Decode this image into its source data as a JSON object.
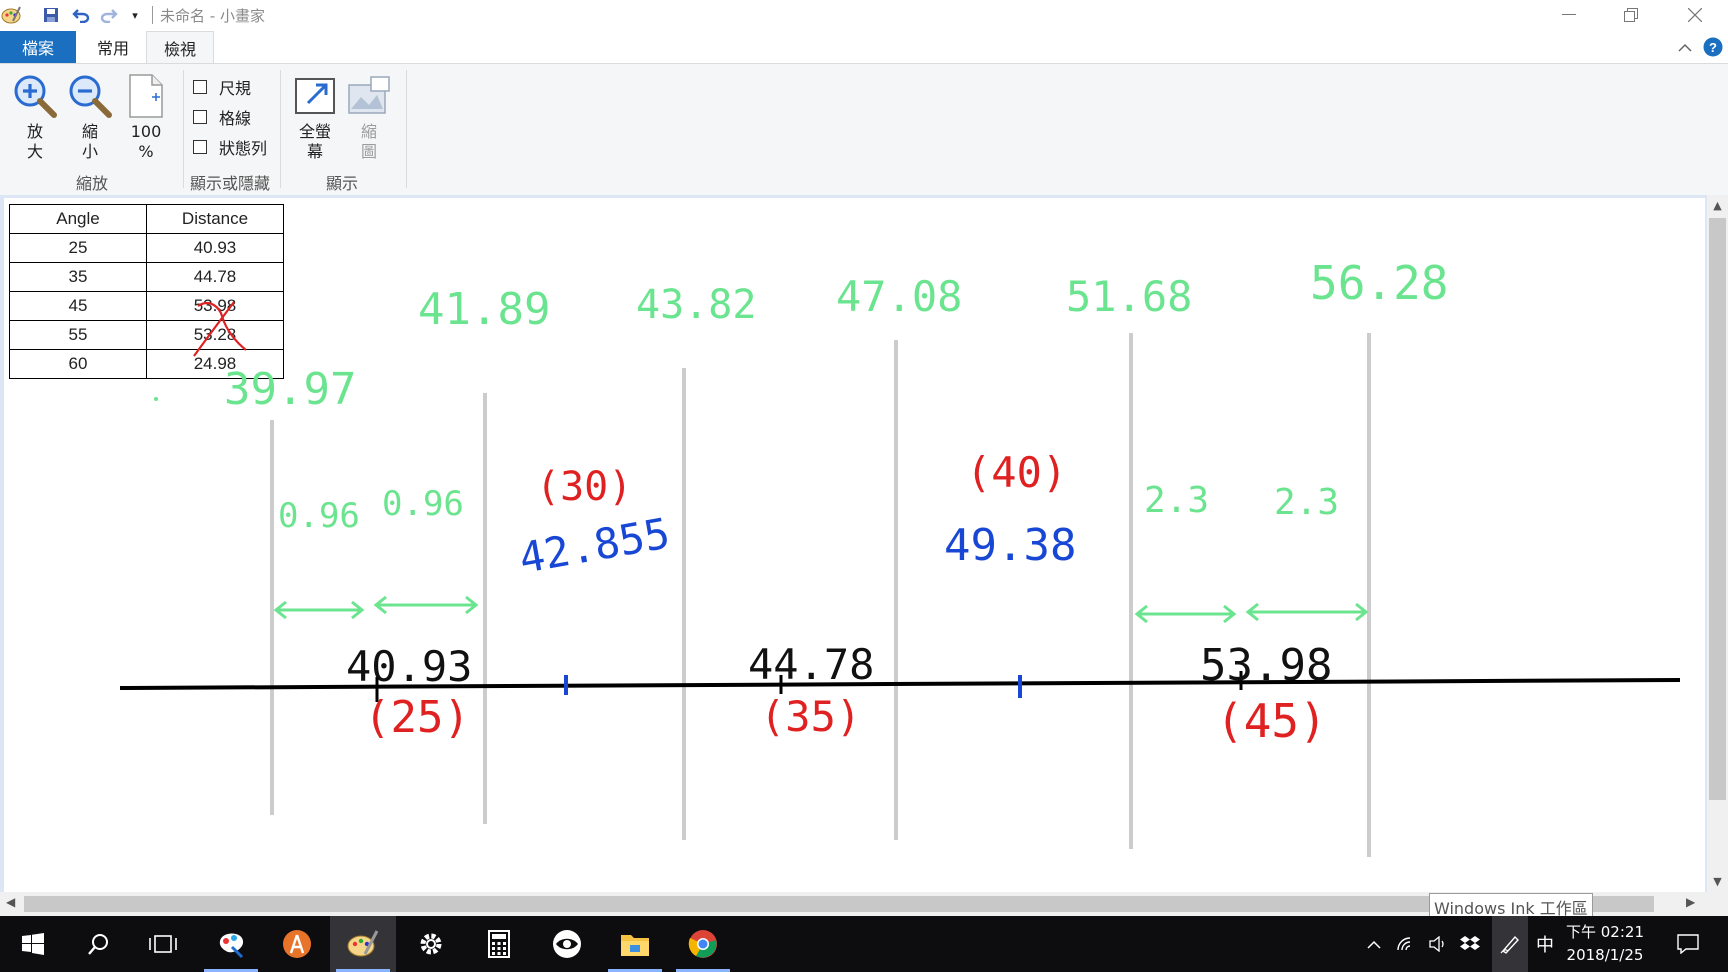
{
  "window": {
    "title": "未命名 - 小畫家",
    "qat_icons": [
      "paint-app-icon",
      "save-icon",
      "undo-icon",
      "redo-icon",
      "customize-dropdown-icon"
    ]
  },
  "tabs": [
    {
      "label": "檔案"
    },
    {
      "label": "常用"
    },
    {
      "label": "檢視"
    }
  ],
  "ribbon": {
    "zoom": {
      "zoom_in": "放\n大",
      "zoom_out": "縮\n小",
      "hundred": "100\n%",
      "group": "縮放"
    },
    "show_hide": {
      "ruler": "尺規",
      "gridlines": "格線",
      "statusbar": "狀態列",
      "group": "顯示或隱藏"
    },
    "display": {
      "fullscreen": "全螢\n幕",
      "thumbnail": "縮\n圖",
      "group": "顯示"
    }
  },
  "table": {
    "headers": [
      "Angle",
      "Distance"
    ],
    "rows": [
      [
        "25",
        "40.93"
      ],
      [
        "35",
        "44.78"
      ],
      [
        "45",
        "53.98"
      ],
      [
        "55",
        "53.28"
      ],
      [
        "60",
        "24.98"
      ]
    ],
    "crossed_out_rows": [
      3,
      4
    ]
  },
  "ink": {
    "green_top": [
      "41.89",
      "43.82",
      "47.08",
      "51.68",
      "56.28"
    ],
    "green_left": "39.97",
    "green_gaps": [
      "0.96",
      "0.96",
      "2.3",
      "2.3"
    ],
    "red": [
      "(30)",
      "(40)",
      "(25)",
      "(35)",
      "(45)"
    ],
    "blue": [
      "42.855",
      "49.38"
    ],
    "black": [
      "40.93",
      "44.78",
      "53.98"
    ]
  },
  "ink_tip": "Windows Ink 工作區",
  "taskbar": {
    "apps": [
      "start-icon",
      "search-icon",
      "task-view-icon",
      "paint3d-icon",
      "orange-app-icon",
      "paint-icon",
      "settings-icon",
      "calculator-icon",
      "eye-app-icon",
      "file-explorer-icon",
      "chrome-icon"
    ],
    "ime": "中",
    "time": "下午 02:21",
    "date": "2018/1/25"
  },
  "colors": {
    "accent": "#1a6fc0",
    "ink_green": "#6be48f",
    "ink_red": "#e02121",
    "ink_blue": "#1847d6"
  }
}
